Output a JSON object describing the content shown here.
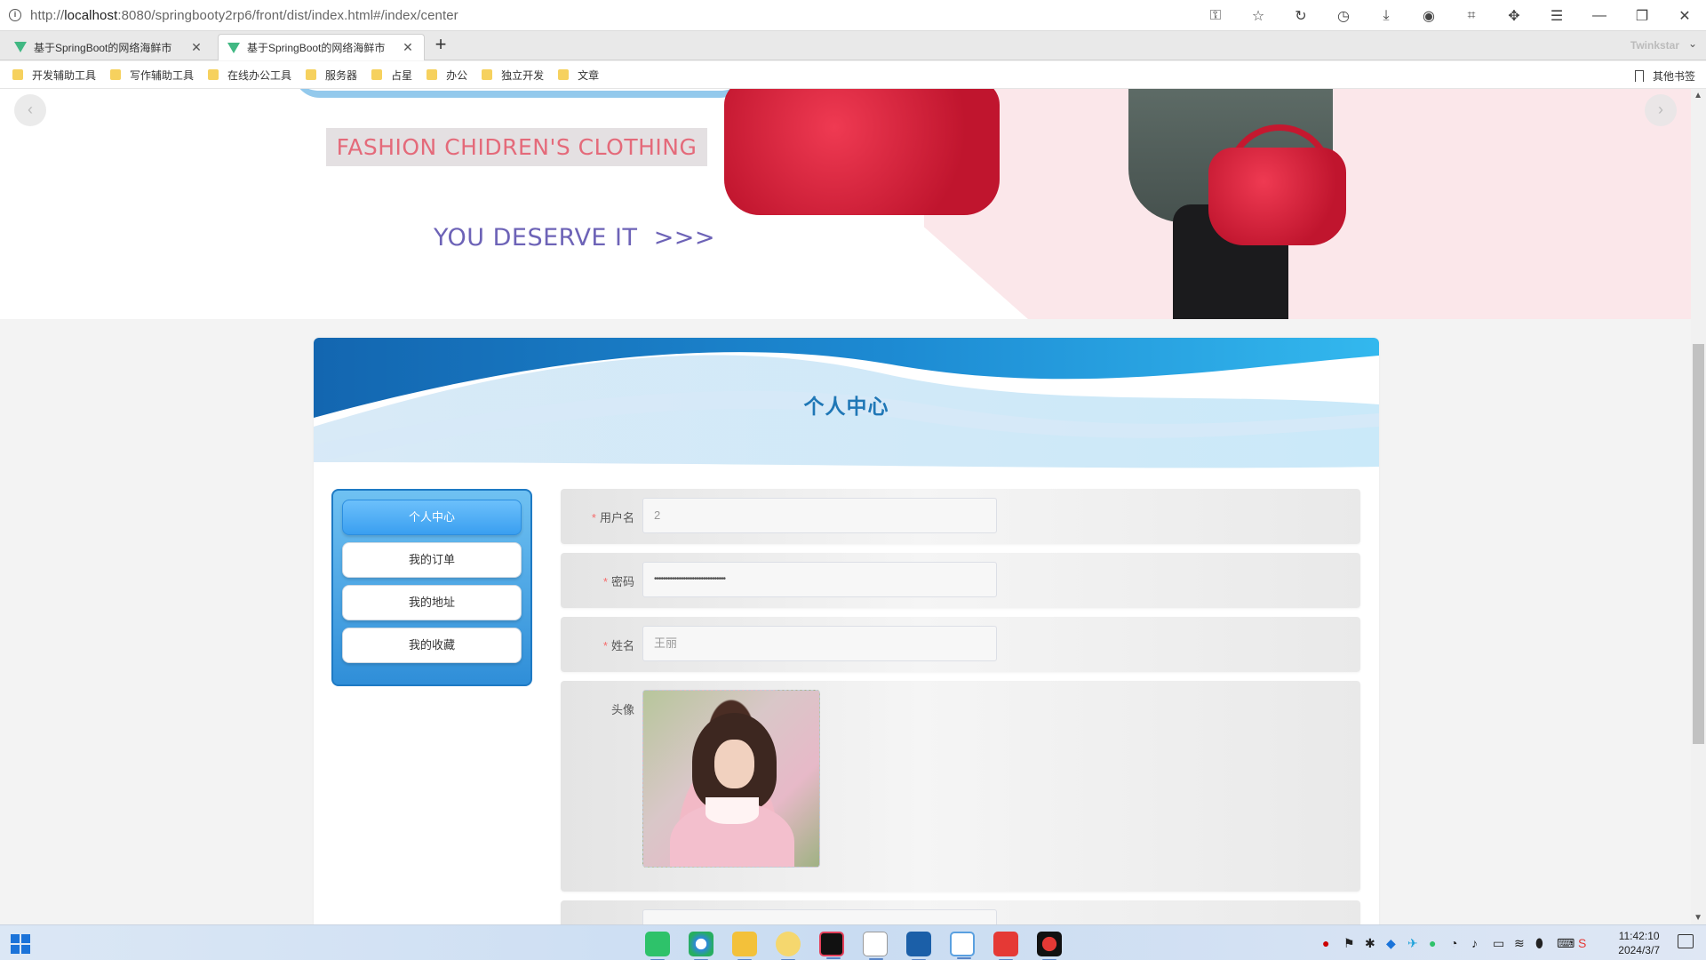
{
  "browser": {
    "url_prefix": "http://",
    "url_host": "localhost",
    "url_rest": ":8080/springbooty2rp6/front/dist/index.html#/index/center",
    "tabs": [
      {
        "label": "基于SpringBoot的网络海鲜市",
        "active": false
      },
      {
        "label": "基于SpringBoot的网络海鲜市",
        "active": true
      }
    ],
    "brand": "Twinkstar",
    "bookmarks": [
      "开发辅助工具",
      "写作辅助工具",
      "在线办公工具",
      "服务器",
      "占星",
      "办公",
      "独立开发",
      "文章"
    ],
    "other_bookmarks": "其他书签"
  },
  "banner": {
    "tagline": "FASHION CHIDREN'S CLOTHING",
    "slogan": "YOU DESERVE IT",
    "arrows": ">>>",
    "prev": "‹",
    "next": "›"
  },
  "page": {
    "title": "个人中心"
  },
  "menu": {
    "items": [
      "个人中心",
      "我的订单",
      "我的地址",
      "我的收藏"
    ],
    "active_index": 0
  },
  "form": {
    "username_label": "用户名",
    "username_value": "2",
    "password_label": "密码",
    "password_value": "••••••••••••••••••••••••••••••••",
    "name_label": "姓名",
    "name_value": "王丽",
    "avatar_label": "头像",
    "required_mark": "*"
  },
  "taskbar": {
    "time": "11:42:10",
    "date": "2024/3/7"
  },
  "colors": {
    "accent": "#1f77b6",
    "menu_active": "#3a9ff0",
    "required": "#f56c6c",
    "banner_pink": "#fbe7ea"
  }
}
